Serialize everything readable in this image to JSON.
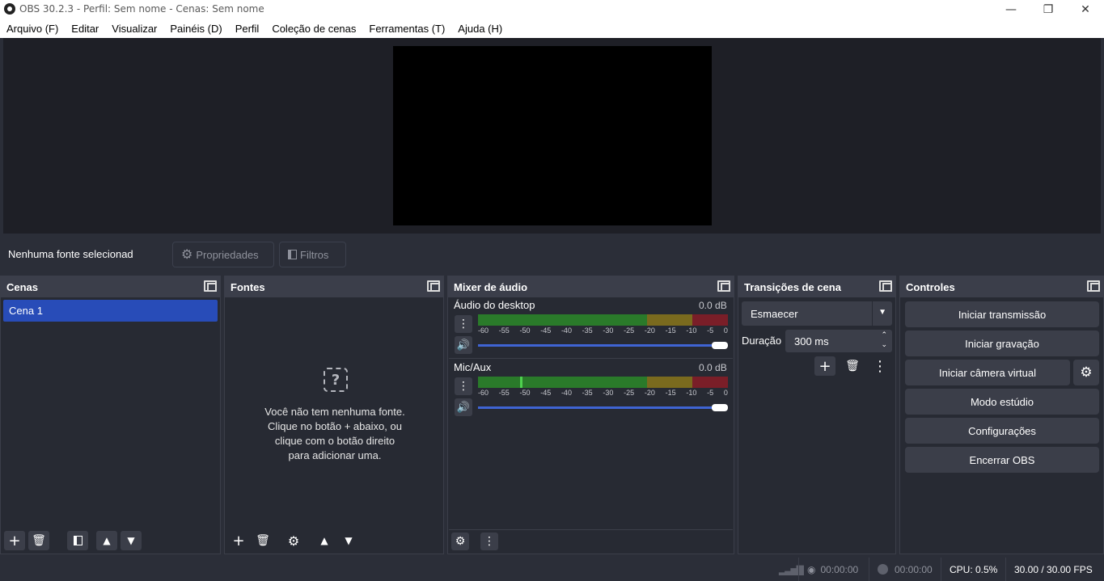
{
  "window": {
    "title": "OBS 30.2.3 - Perfil: Sem nome - Cenas: Sem nome"
  },
  "menu": [
    "Arquivo (F)",
    "Editar",
    "Visualizar",
    "Painéis (D)",
    "Perfil",
    "Coleção de cenas",
    "Ferramentas (T)",
    "Ajuda (H)"
  ],
  "sourcebar": {
    "no_source": "Nenhuma fonte selecionad",
    "properties": "Propriedades",
    "filters": "Filtros"
  },
  "scenes": {
    "title": "Cenas",
    "items": [
      "Cena 1"
    ]
  },
  "sources": {
    "title": "Fontes",
    "empty_lines": [
      "Você não tem nenhuma fonte.",
      "Clique no botão + abaixo, ou",
      "clique com o botão direito",
      "para adicionar uma."
    ]
  },
  "mixer": {
    "title": "Mixer de áudio",
    "channels": [
      {
        "name": "Áudio do desktop",
        "db": "0.0 dB"
      },
      {
        "name": "Mic/Aux",
        "db": "0.0 dB"
      }
    ],
    "ticks": [
      "-60",
      "-55",
      "-50",
      "-45",
      "-40",
      "-35",
      "-30",
      "-25",
      "-20",
      "-15",
      "-10",
      "-5",
      "0"
    ]
  },
  "transitions": {
    "title": "Transições de cena",
    "selected": "Esmaecer",
    "duration_label": "Duração",
    "duration_value": "300 ms"
  },
  "controls": {
    "title": "Controles",
    "start_stream": "Iniciar transmissão",
    "start_record": "Iniciar gravação",
    "virtual_cam": "Iniciar câmera virtual",
    "studio_mode": "Modo estúdio",
    "settings": "Configurações",
    "exit": "Encerrar OBS"
  },
  "status": {
    "stream_time": "00:00:00",
    "record_time": "00:00:00",
    "cpu": "CPU: 0.5%",
    "fps": "30.00 / 30.00 FPS"
  },
  "colors": {
    "accent": "#284cb8",
    "slider": "#3f64d3",
    "meter_green": "#2a7a2a",
    "meter_yellow": "#7a6a1e",
    "meter_red": "#7a1e28"
  }
}
